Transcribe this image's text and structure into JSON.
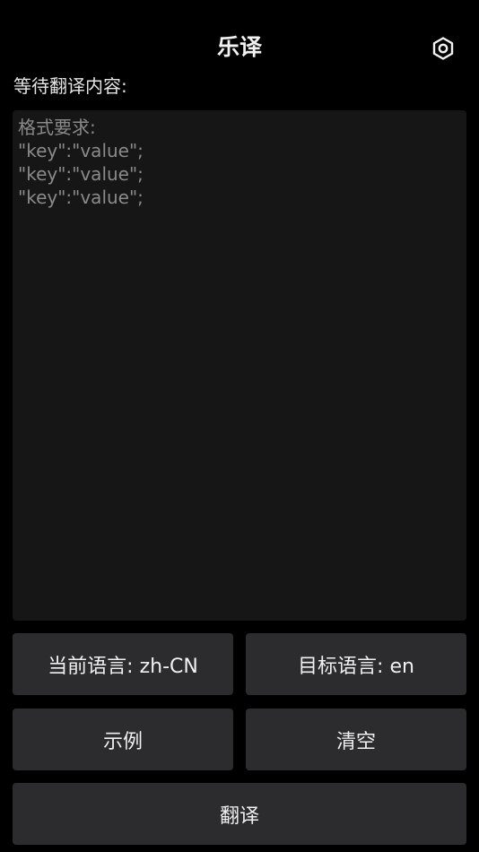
{
  "header": {
    "title": "乐译",
    "settings_icon": "settings-hexagon-icon"
  },
  "input_section": {
    "label": "等待翻译内容:",
    "value": "",
    "placeholder": "格式要求:\n\"key\":\"value\";\n\"key\":\"value\";\n\"key\":\"value\";"
  },
  "language": {
    "source_label": "当前语言: zh-CN",
    "target_label": "目标语言: en"
  },
  "actions": {
    "example_label": "示例",
    "clear_label": "清空",
    "translate_label": "翻译"
  },
  "colors": {
    "background": "#000000",
    "input_background": "#161616",
    "button_background": "#2c2c2e",
    "text": "#f0f0f0",
    "placeholder": "#8a8a8a"
  }
}
